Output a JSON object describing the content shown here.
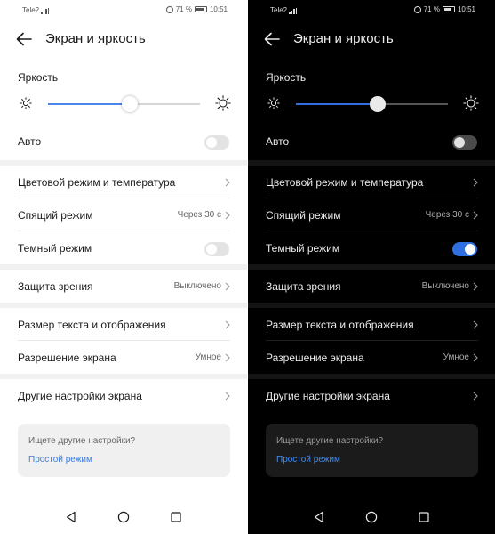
{
  "screens": [
    {
      "theme": "light",
      "status": {
        "carrier": "Tele2",
        "battery": "71 %",
        "time": "10:51"
      },
      "title": "Экран и яркость",
      "brightness": {
        "label": "Яркость",
        "level": 0.54
      },
      "auto": {
        "label": "Авто",
        "on": false
      },
      "items": {
        "color_mode": "Цветовой режим и температура",
        "sleep": {
          "label": "Спящий режим",
          "value": "Через 30 с"
        },
        "dark_mode": {
          "label": "Темный режим",
          "on": false
        },
        "eye_protection": {
          "label": "Защита зрения",
          "value": "Выключено"
        },
        "text_size": "Размер текста и отображения",
        "resolution": {
          "label": "Разрешение экрана",
          "value": "Умное"
        },
        "other": "Другие настройки экрана"
      },
      "card": {
        "question": "Ищете другие настройки?",
        "link": "Простой режим"
      }
    },
    {
      "theme": "dark",
      "status": {
        "carrier": "Tele2",
        "battery": "71 %",
        "time": "10:51"
      },
      "title": "Экран и яркость",
      "brightness": {
        "label": "Яркость",
        "level": 0.54
      },
      "auto": {
        "label": "Авто",
        "on": false
      },
      "items": {
        "color_mode": "Цветовой режим и температура",
        "sleep": {
          "label": "Спящий режим",
          "value": "Через 30 с"
        },
        "dark_mode": {
          "label": "Темный режим",
          "on": true
        },
        "eye_protection": {
          "label": "Защита зрения",
          "value": "Выключено"
        },
        "text_size": "Размер текста и отображения",
        "resolution": {
          "label": "Разрешение экрана",
          "value": "Умное"
        },
        "other": "Другие настройки экрана"
      },
      "card": {
        "question": "Ищете другие настройки?",
        "link": "Простой режим"
      }
    }
  ],
  "icons": {
    "back": "arrow-left-icon",
    "sun_small": "sun-small-icon",
    "sun_large": "sun-large-icon",
    "chevron": "chevron-right-icon",
    "nav_back": "triangle-back-icon",
    "nav_home": "circle-home-icon",
    "nav_recent": "square-recent-icon"
  },
  "colors": {
    "accent_light": "#4a86e8",
    "accent_dark": "#2f6fe0",
    "link": "#3a7be0"
  }
}
